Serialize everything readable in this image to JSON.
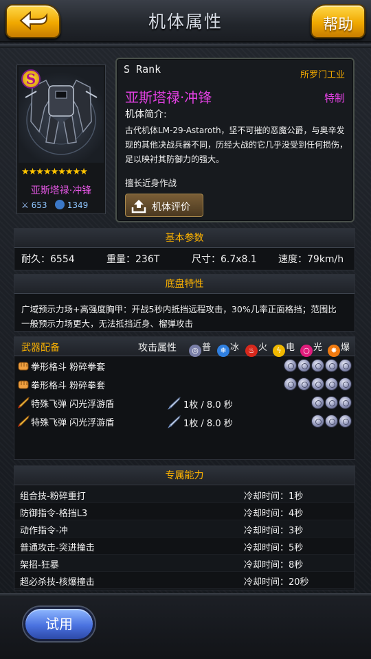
{
  "header": {
    "title": "机体属性",
    "help_label": "帮助"
  },
  "unit": {
    "grade_badge": "S",
    "stars": "★★★★★★★★★",
    "name": "亚斯塔禄·冲锋",
    "attack": "653",
    "defense": "1349"
  },
  "info": {
    "rank": "S Rank",
    "maker": "所罗门工业",
    "name": "亚斯塔禄·冲锋",
    "special_tag": "特制",
    "intro_label": "机体简介:",
    "intro_text": "古代机体LM-29-Astaroth，坚不可摧的恶魔公爵，与奥辛发现的其他决战兵器不同，历经大战的它几乎没受到任何损伤，足以映衬其防御力的强大。",
    "specialty": "擅长近身作战",
    "eval_button": "机体评价"
  },
  "basic": {
    "title": "基本参数",
    "durability": "耐久：6554",
    "weight": "重量：236T",
    "size": "尺寸：6.7x8.1",
    "speed": "速度：79km/h"
  },
  "chassis": {
    "title": "底盘特性",
    "line1": "广域预示力场+高强度胸甲：开战5秒内抵挡远程攻击，30%几率正面格挡；范围比",
    "line2": "一般预示力场更大，无法抵挡近身、榴弹攻击"
  },
  "weapons": {
    "title": "武器配备",
    "attr_label": "攻击属性",
    "elements": [
      {
        "label": "普",
        "color": "#7a7fa8"
      },
      {
        "label": "冰",
        "color": "#2f7fe0"
      },
      {
        "label": "火",
        "color": "#d8281c"
      },
      {
        "label": "电",
        "color": "#f0b800"
      },
      {
        "label": "光",
        "color": "#e01c7c"
      },
      {
        "label": "爆",
        "color": "#f07a10"
      }
    ],
    "rows": [
      {
        "name": "拳形格斗  粉碎拳套",
        "ammo": "",
        "orbs": 5,
        "icon": "fist-icon"
      },
      {
        "name": "拳形格斗  粉碎拳套",
        "ammo": "",
        "orbs": 5,
        "icon": "fist-icon"
      },
      {
        "name": "特殊飞弹  闪光浮游盾",
        "ammo": "1枚 / 8.0 秒",
        "orbs": 3,
        "icon": "missile-icon"
      },
      {
        "name": "特殊飞弹  闪光浮游盾",
        "ammo": "1枚 / 8.0 秒",
        "orbs": 3,
        "icon": "missile-icon"
      }
    ]
  },
  "abilities": {
    "title": "专属能力",
    "rows": [
      {
        "name": "组合技-粉碎重打",
        "cooldown": "冷却时间：1秒"
      },
      {
        "name": "防御指令-格挡L3",
        "cooldown": "冷却时间：4秒"
      },
      {
        "name": "动作指令-冲",
        "cooldown": "冷却时间：3秒"
      },
      {
        "name": "普通攻击-突进撞击",
        "cooldown": "冷却时间：5秒"
      },
      {
        "name": "架招-狂暴",
        "cooldown": "冷却时间：8秒"
      },
      {
        "name": "超必杀技-核爆撞击",
        "cooldown": "冷却时间：20秒"
      }
    ]
  },
  "footer": {
    "try_button": "试用"
  }
}
